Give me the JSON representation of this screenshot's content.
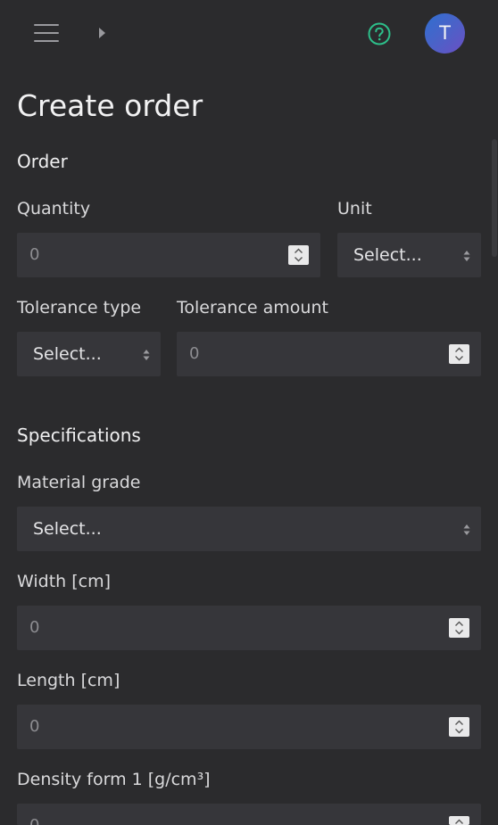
{
  "header": {
    "menu_icon": "hamburger-menu-icon",
    "breadcrumb_icon": "chevron-right-icon",
    "help_icon": "question-circle-icon",
    "avatar_initial": "T",
    "help_color": "#2dbf8a"
  },
  "page": {
    "title": "Create order"
  },
  "order": {
    "section_title": "Order",
    "quantity": {
      "label": "Quantity",
      "placeholder": "0"
    },
    "unit": {
      "label": "Unit",
      "value": "Select..."
    },
    "tolerance_type": {
      "label": "Tolerance type",
      "value": "Select..."
    },
    "tolerance_amount": {
      "label": "Tolerance amount",
      "placeholder": "0"
    }
  },
  "specifications": {
    "section_title": "Specifications",
    "material_grade": {
      "label": "Material grade",
      "value": "Select..."
    },
    "width": {
      "label": "Width [cm]",
      "placeholder": "0"
    },
    "length": {
      "label": "Length [cm]",
      "placeholder": "0"
    },
    "density": {
      "label": "Density form 1 [g/cm³]",
      "placeholder": "0"
    }
  }
}
